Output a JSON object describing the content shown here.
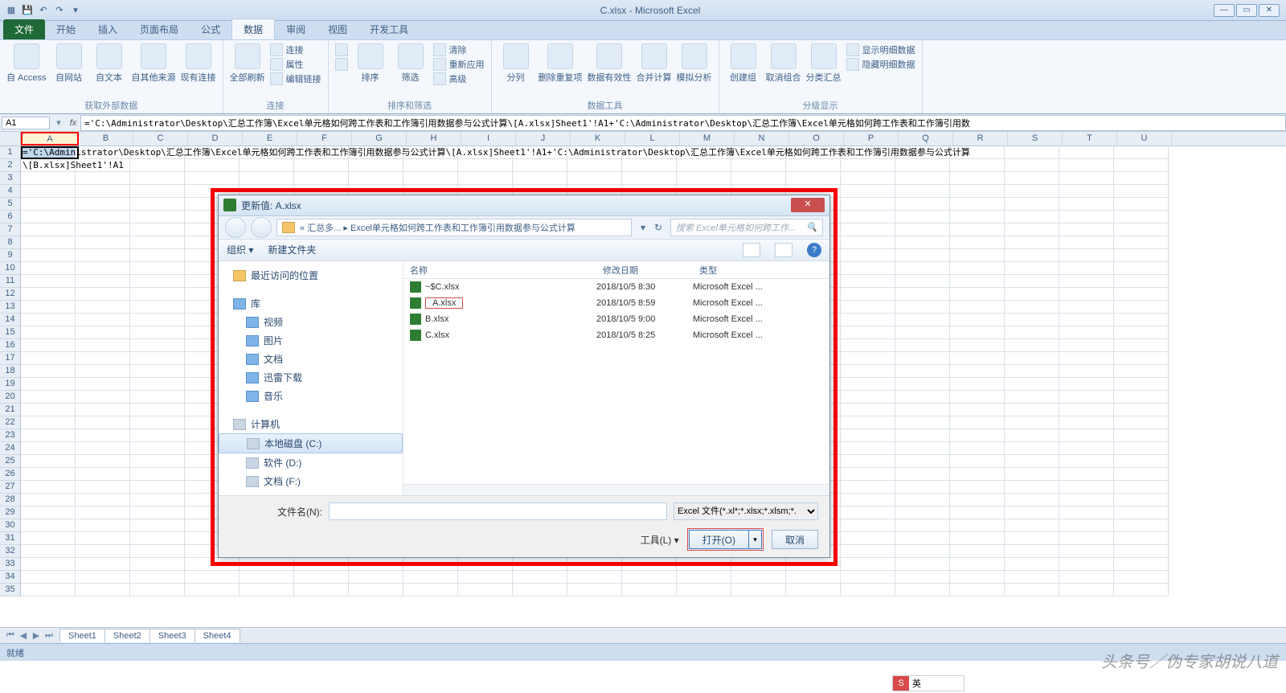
{
  "window": {
    "title": "C.xlsx - Microsoft Excel"
  },
  "qat": {
    "save": "💾",
    "undo": "↶",
    "redo": "↷"
  },
  "tabs": {
    "file": "文件",
    "home": "开始",
    "insert": "插入",
    "layout": "页面布局",
    "formulas": "公式",
    "data": "数据",
    "review": "审阅",
    "view": "视图",
    "dev": "开发工具"
  },
  "ribbon": {
    "ext_data": {
      "access": "自 Access",
      "web": "自网站",
      "text": "自文本",
      "other": "自其他来源",
      "existing": "现有连接",
      "group": "获取外部数据"
    },
    "conn": {
      "refresh": "全部刷新",
      "connections": "连接",
      "props": "属性",
      "editlinks": "编辑链接",
      "group": "连接"
    },
    "sort": {
      "az": "A↓Z",
      "za": "Z↓A",
      "sort": "排序",
      "filter": "筛选",
      "clear": "清除",
      "reapply": "重新应用",
      "advanced": "高级",
      "group": "排序和筛选"
    },
    "tools": {
      "t2c": "分列",
      "dup": "删除重复项",
      "valid": "数据有效性",
      "consol": "合并计算",
      "whatif": "模拟分析",
      "group": "数据工具"
    },
    "outline": {
      "grp": "创建组",
      "ungrp": "取消组合",
      "subtotal": "分类汇总",
      "show": "显示明细数据",
      "hide": "隐藏明细数据",
      "group": "分级显示"
    }
  },
  "formula_bar": {
    "namebox": "A1",
    "formula": "='C:\\Administrator\\Desktop\\汇总工作簿\\Excel单元格如何跨工作表和工作簿引用数据参与公式计算\\[A.xlsx]Sheet1'!A1+'C:\\Administrator\\Desktop\\汇总工作簿\\Excel单元格如何跨工作表和工作簿引用数"
  },
  "cols": [
    "A",
    "B",
    "C",
    "D",
    "E",
    "F",
    "G",
    "H",
    "I",
    "J",
    "K",
    "L",
    "M",
    "N",
    "O",
    "P",
    "Q",
    "R",
    "S",
    "T",
    "U"
  ],
  "rows": {
    "r1": "='C:\\Administrator\\Desktop\\汇总工作簿\\Excel单元格如何跨工作表和工作簿引用数据参与公式计算\\[A.xlsx]Sheet1'!A1+'C:\\Administrator\\Desktop\\汇总工作簿\\Excel单元格如何跨工作表和工作簿引用数据参与公式计算",
    "r2": "\\[B.xlsx]Sheet1'!A1"
  },
  "sheets": [
    "Sheet1",
    "Sheet2",
    "Sheet3",
    "Sheet4"
  ],
  "status": "就绪",
  "dialog": {
    "title": "更新值: A.xlsx",
    "breadcrumb": "« 汇总多...  ▸  Excel单元格如何跨工作表和工作簿引用数据参与公式计算",
    "search_placeholder": "搜索 Excel单元格如何跨工作...",
    "organize": "组织",
    "newfolder": "新建文件夹",
    "side": {
      "recent": "最近访问的位置",
      "library": "库",
      "video": "视频",
      "pictures": "图片",
      "documents": "文档",
      "thunder": "迅雷下载",
      "music": "音乐",
      "computer": "计算机",
      "cdrive": "本地磁盘 (C:)",
      "ddrive": "软件 (D:)",
      "edrive": "文档 (F:)"
    },
    "columns": {
      "name": "名称",
      "date": "修改日期",
      "type": "类型"
    },
    "files": [
      {
        "name": "~$C.xlsx",
        "date": "2018/10/5 8:30",
        "type": "Microsoft Excel ..."
      },
      {
        "name": "A.xlsx",
        "date": "2018/10/5 8:59",
        "type": "Microsoft Excel ...",
        "highlight": true
      },
      {
        "name": "B.xlsx",
        "date": "2018/10/5 9:00",
        "type": "Microsoft Excel ..."
      },
      {
        "name": "C.xlsx",
        "date": "2018/10/5 8:25",
        "type": "Microsoft Excel ..."
      }
    ],
    "filename_label": "文件名(N):",
    "filetype": "Excel 文件(*.xl*;*.xlsx;*.xlsm;*. ",
    "tools": "工具(L)",
    "open": "打开(O)",
    "cancel": "取消"
  },
  "watermark": "头条号／伪专家胡说八道",
  "ime": "英"
}
